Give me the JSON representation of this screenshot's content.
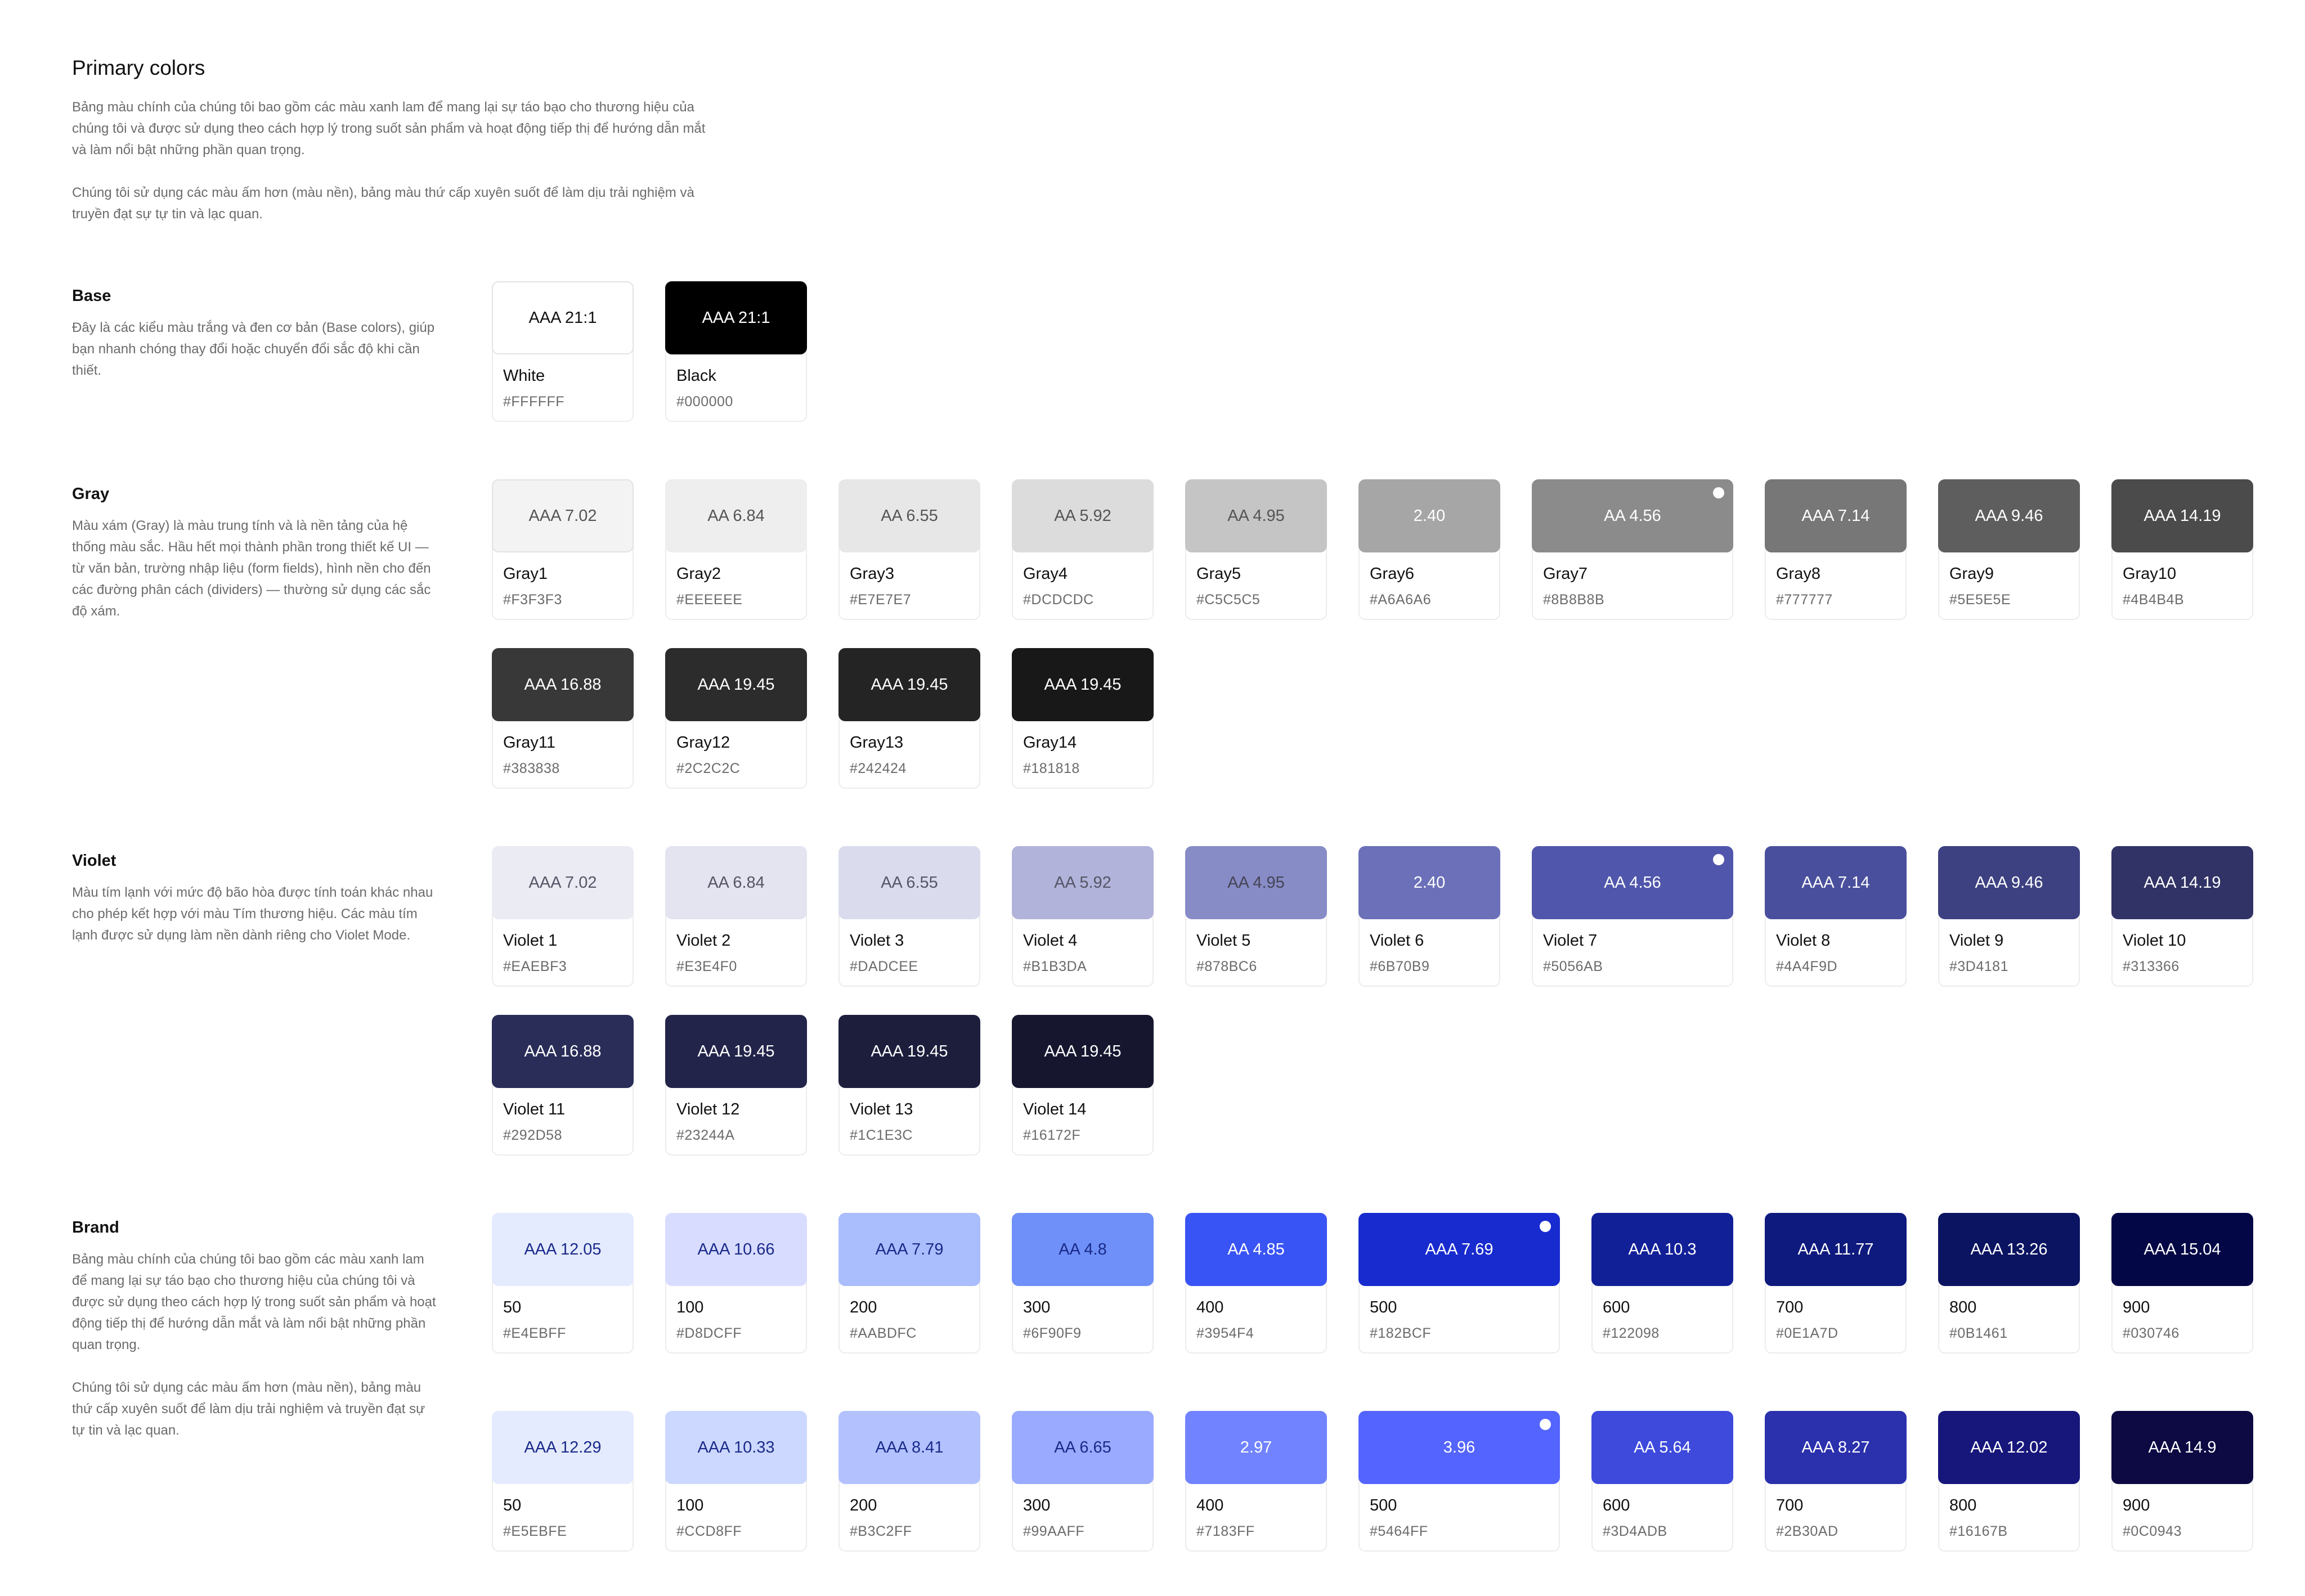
{
  "page": {
    "title": "Primary colors",
    "intro": [
      "Bảng màu chính của chúng tôi bao gồm các màu xanh lam để mang lại sự táo bạo cho thương hiệu của chúng tôi và được sử dụng theo cách hợp lý trong suốt sản phẩm và hoạt động tiếp thị để hướng dẫn mắt và làm nổi bật những phần quan trọng.",
      "Chúng tôi sử dụng các màu ấm hơn (màu nền), bảng màu thứ cấp xuyên suốt để làm dịu trải nghiệm và truyền đạt sự tự tin và lạc quan."
    ]
  },
  "sections": [
    {
      "id": "base",
      "title": "Base",
      "desc": [
        "Đây là các kiểu màu trắng và đen cơ bản (Base colors), giúp bạn nhanh chóng thay đổi hoặc chuyển đổi sắc độ khi cần thiết."
      ],
      "rows": [
        [
          {
            "name": "White",
            "hex": "#FFFFFF",
            "label": "AAA 21:1",
            "bg": "#FFFFFF",
            "fg": "#111111"
          },
          {
            "name": "Black",
            "hex": "#000000",
            "label": "AAA 21:1",
            "bg": "#000000",
            "fg": "#FFFFFF"
          }
        ]
      ]
    },
    {
      "id": "gray",
      "title": "Gray",
      "desc": [
        "Màu xám (Gray) là màu trung tính và là nền tảng của hệ thống màu sắc. Hầu hết mọi thành phần trong thiết kế UI — từ văn bản, trường nhập liệu (form fields), hình nền cho đến các đường phân cách (dividers) — thường sử dụng các sắc độ xám."
      ],
      "rows": [
        [
          {
            "name": "Gray1",
            "hex": "#F3F3F3",
            "label": "AAA 7.02",
            "bg": "#F3F3F3",
            "fg": "#555555"
          },
          {
            "name": "Gray2",
            "hex": "#EEEEEE",
            "label": "AA 6.84",
            "bg": "#EEEEEE",
            "fg": "#555555"
          },
          {
            "name": "Gray3",
            "hex": "#E7E7E7",
            "label": "AA 6.55",
            "bg": "#E7E7E7",
            "fg": "#555555"
          },
          {
            "name": "Gray4",
            "hex": "#DCDCDC",
            "label": "AA 5.92",
            "bg": "#DCDCDC",
            "fg": "#555555"
          },
          {
            "name": "Gray5",
            "hex": "#C5C5C5",
            "label": "AA 4.95",
            "bg": "#C5C5C5",
            "fg": "#555555"
          },
          {
            "name": "Gray6",
            "hex": "#A6A6A6",
            "label": "2.40",
            "bg": "#A6A6A6",
            "fg": "#FFFFFF"
          },
          {
            "name": "Gray7",
            "hex": "#8B8B8B",
            "label": "AA 4.56",
            "bg": "#8B8B8B",
            "fg": "#FFFFFF",
            "selected": true
          },
          {
            "name": "Gray8",
            "hex": "#777777",
            "label": "AAA 7.14",
            "bg": "#777777",
            "fg": "#FFFFFF"
          },
          {
            "name": "Gray9",
            "hex": "#5E5E5E",
            "label": "AAA 9.46",
            "bg": "#5E5E5E",
            "fg": "#FFFFFF"
          },
          {
            "name": "Gray10",
            "hex": "#4B4B4B",
            "label": "AAA 14.19",
            "bg": "#4B4B4B",
            "fg": "#FFFFFF"
          }
        ],
        [
          {
            "name": "Gray11",
            "hex": "#383838",
            "label": "AAA 16.88",
            "bg": "#383838",
            "fg": "#FFFFFF"
          },
          {
            "name": "Gray12",
            "hex": "#2C2C2C",
            "label": "AAA 19.45",
            "bg": "#2C2C2C",
            "fg": "#FFFFFF"
          },
          {
            "name": "Gray13",
            "hex": "#242424",
            "label": "AAA 19.45",
            "bg": "#242424",
            "fg": "#FFFFFF"
          },
          {
            "name": "Gray14",
            "hex": "#181818",
            "label": "AAA 19.45",
            "bg": "#181818",
            "fg": "#FFFFFF"
          }
        ]
      ]
    },
    {
      "id": "violet",
      "title": "Violet",
      "desc": [
        "Màu tím lạnh với mức độ bão hòa được tính toán khác nhau cho phép kết hợp với màu Tím thương hiệu. Các màu tím lạnh được sử dụng làm nền dành riêng cho Violet Mode."
      ],
      "rows": [
        [
          {
            "name": "Violet 1",
            "hex": "#EAEBF3",
            "label": "AAA 7.02",
            "bg": "#EAEBF3",
            "fg": "#555566"
          },
          {
            "name": "Violet 2",
            "hex": "#E3E4F0",
            "label": "AA 6.84",
            "bg": "#E3E4F0",
            "fg": "#555566"
          },
          {
            "name": "Violet 3",
            "hex": "#DADCEE",
            "label": "AA 6.55",
            "bg": "#DADCEE",
            "fg": "#555566"
          },
          {
            "name": "Violet 4",
            "hex": "#B1B3DA",
            "label": "AA 5.92",
            "bg": "#B1B3DA",
            "fg": "#555566"
          },
          {
            "name": "Violet 5",
            "hex": "#878BC6",
            "label": "AA 4.95",
            "bg": "#878BC6",
            "fg": "#444455"
          },
          {
            "name": "Violet 6",
            "hex": "#6B70B9",
            "label": "2.40",
            "bg": "#6B70B9",
            "fg": "#FFFFFF"
          },
          {
            "name": "Violet 7",
            "hex": "#5056AB",
            "label": "AA 4.56",
            "bg": "#5056AB",
            "fg": "#FFFFFF",
            "selected": true
          },
          {
            "name": "Violet 8",
            "hex": "#4A4F9D",
            "label": "AAA 7.14",
            "bg": "#4A4F9D",
            "fg": "#FFFFFF"
          },
          {
            "name": "Violet 9",
            "hex": "#3D4181",
            "label": "AAA 9.46",
            "bg": "#3D4181",
            "fg": "#FFFFFF"
          },
          {
            "name": "Violet 10",
            "hex": "#313366",
            "label": "AAA 14.19",
            "bg": "#313366",
            "fg": "#FFFFFF"
          }
        ],
        [
          {
            "name": "Violet 11",
            "hex": "#292D58",
            "label": "AAA 16.88",
            "bg": "#292D58",
            "fg": "#FFFFFF"
          },
          {
            "name": "Violet 12",
            "hex": "#23244A",
            "label": "AAA 19.45",
            "bg": "#23244A",
            "fg": "#FFFFFF"
          },
          {
            "name": "Violet 13",
            "hex": "#1C1E3C",
            "label": "AAA 19.45",
            "bg": "#1C1E3C",
            "fg": "#FFFFFF"
          },
          {
            "name": "Violet 14",
            "hex": "#16172F",
            "label": "AAA 19.45",
            "bg": "#16172F",
            "fg": "#FFFFFF"
          }
        ]
      ]
    },
    {
      "id": "brand",
      "title": "Brand",
      "desc": [
        "Bảng màu chính của chúng tôi bao gồm các màu xanh lam để mang lại sự táo bạo cho thương hiệu của chúng tôi và được sử dụng theo cách hợp lý trong suốt sản phẩm và hoạt động tiếp thị để hướng dẫn mắt và làm nổi bật những phần quan trọng.",
        "Chúng tôi sử dụng các màu ấm hơn (màu nền), bảng màu thứ cấp xuyên suốt để làm dịu trải nghiệm và truyền đạt sự tự tin và lạc quan."
      ],
      "rows": [
        [
          {
            "name": "50",
            "hex": "#E4EBFF",
            "label": "AAA 12.05",
            "bg": "#E4EBFF",
            "fg": "#1A2A8A"
          },
          {
            "name": "100",
            "hex": "#D8DCFF",
            "label": "AAA 10.66",
            "bg": "#D8DCFF",
            "fg": "#1A2A8A"
          },
          {
            "name": "200",
            "hex": "#AABDFC",
            "label": "AAA 7.79",
            "bg": "#AABDFC",
            "fg": "#1A2A8A"
          },
          {
            "name": "300",
            "hex": "#6F90F9",
            "label": "AA 4.8",
            "bg": "#6F90F9",
            "fg": "#1A2A8A"
          },
          {
            "name": "400",
            "hex": "#3954F4",
            "label": "AA 4.85",
            "bg": "#3954F4",
            "fg": "#FFFFFF"
          },
          {
            "name": "500",
            "hex": "#182BCF",
            "label": "AAA 7.69",
            "bg": "#182BCF",
            "fg": "#FFFFFF",
            "selected": true
          },
          {
            "name": "600",
            "hex": "#122098",
            "label": "AAA 10.3",
            "bg": "#122098",
            "fg": "#FFFFFF"
          },
          {
            "name": "700",
            "hex": "#0E1A7D",
            "label": "AAA 11.77",
            "bg": "#0E1A7D",
            "fg": "#FFFFFF"
          },
          {
            "name": "800",
            "hex": "#0B1461",
            "label": "AAA 13.26",
            "bg": "#0B1461",
            "fg": "#FFFFFF"
          },
          {
            "name": "900",
            "hex": "#030746",
            "label": "AAA 15.04",
            "bg": "#030746",
            "fg": "#FFFFFF"
          }
        ],
        [
          {
            "name": "50",
            "hex": "#E5EBFE",
            "label": "AAA 12.29",
            "bg": "#E5EBFE",
            "fg": "#1A2A8A"
          },
          {
            "name": "100",
            "hex": "#CCD8FF",
            "label": "AAA 10.33",
            "bg": "#CCD8FF",
            "fg": "#1A2A8A"
          },
          {
            "name": "200",
            "hex": "#B3C2FF",
            "label": "AAA 8.41",
            "bg": "#B3C2FF",
            "fg": "#1A2A8A"
          },
          {
            "name": "300",
            "hex": "#99AAFF",
            "label": "AA 6.65",
            "bg": "#99AAFF",
            "fg": "#1A2A8A"
          },
          {
            "name": "400",
            "hex": "#7183FF",
            "label": "2.97",
            "bg": "#7183FF",
            "fg": "#FFFFFF"
          },
          {
            "name": "500",
            "hex": "#5464FF",
            "label": "3.96",
            "bg": "#5464FF",
            "fg": "#FFFFFF",
            "selected": true
          },
          {
            "name": "600",
            "hex": "#3D4ADB",
            "label": "AA 5.64",
            "bg": "#3D4ADB",
            "fg": "#FFFFFF"
          },
          {
            "name": "700",
            "hex": "#2B30AD",
            "label": "AAA 8.27",
            "bg": "#2B30AD",
            "fg": "#FFFFFF"
          },
          {
            "name": "800",
            "hex": "#16167B",
            "label": "AAA 12.02",
            "bg": "#16167B",
            "fg": "#FFFFFF"
          },
          {
            "name": "900",
            "hex": "#0C0943",
            "label": "AAA 14.9",
            "bg": "#0C0943",
            "fg": "#FFFFFF"
          }
        ]
      ]
    }
  ]
}
